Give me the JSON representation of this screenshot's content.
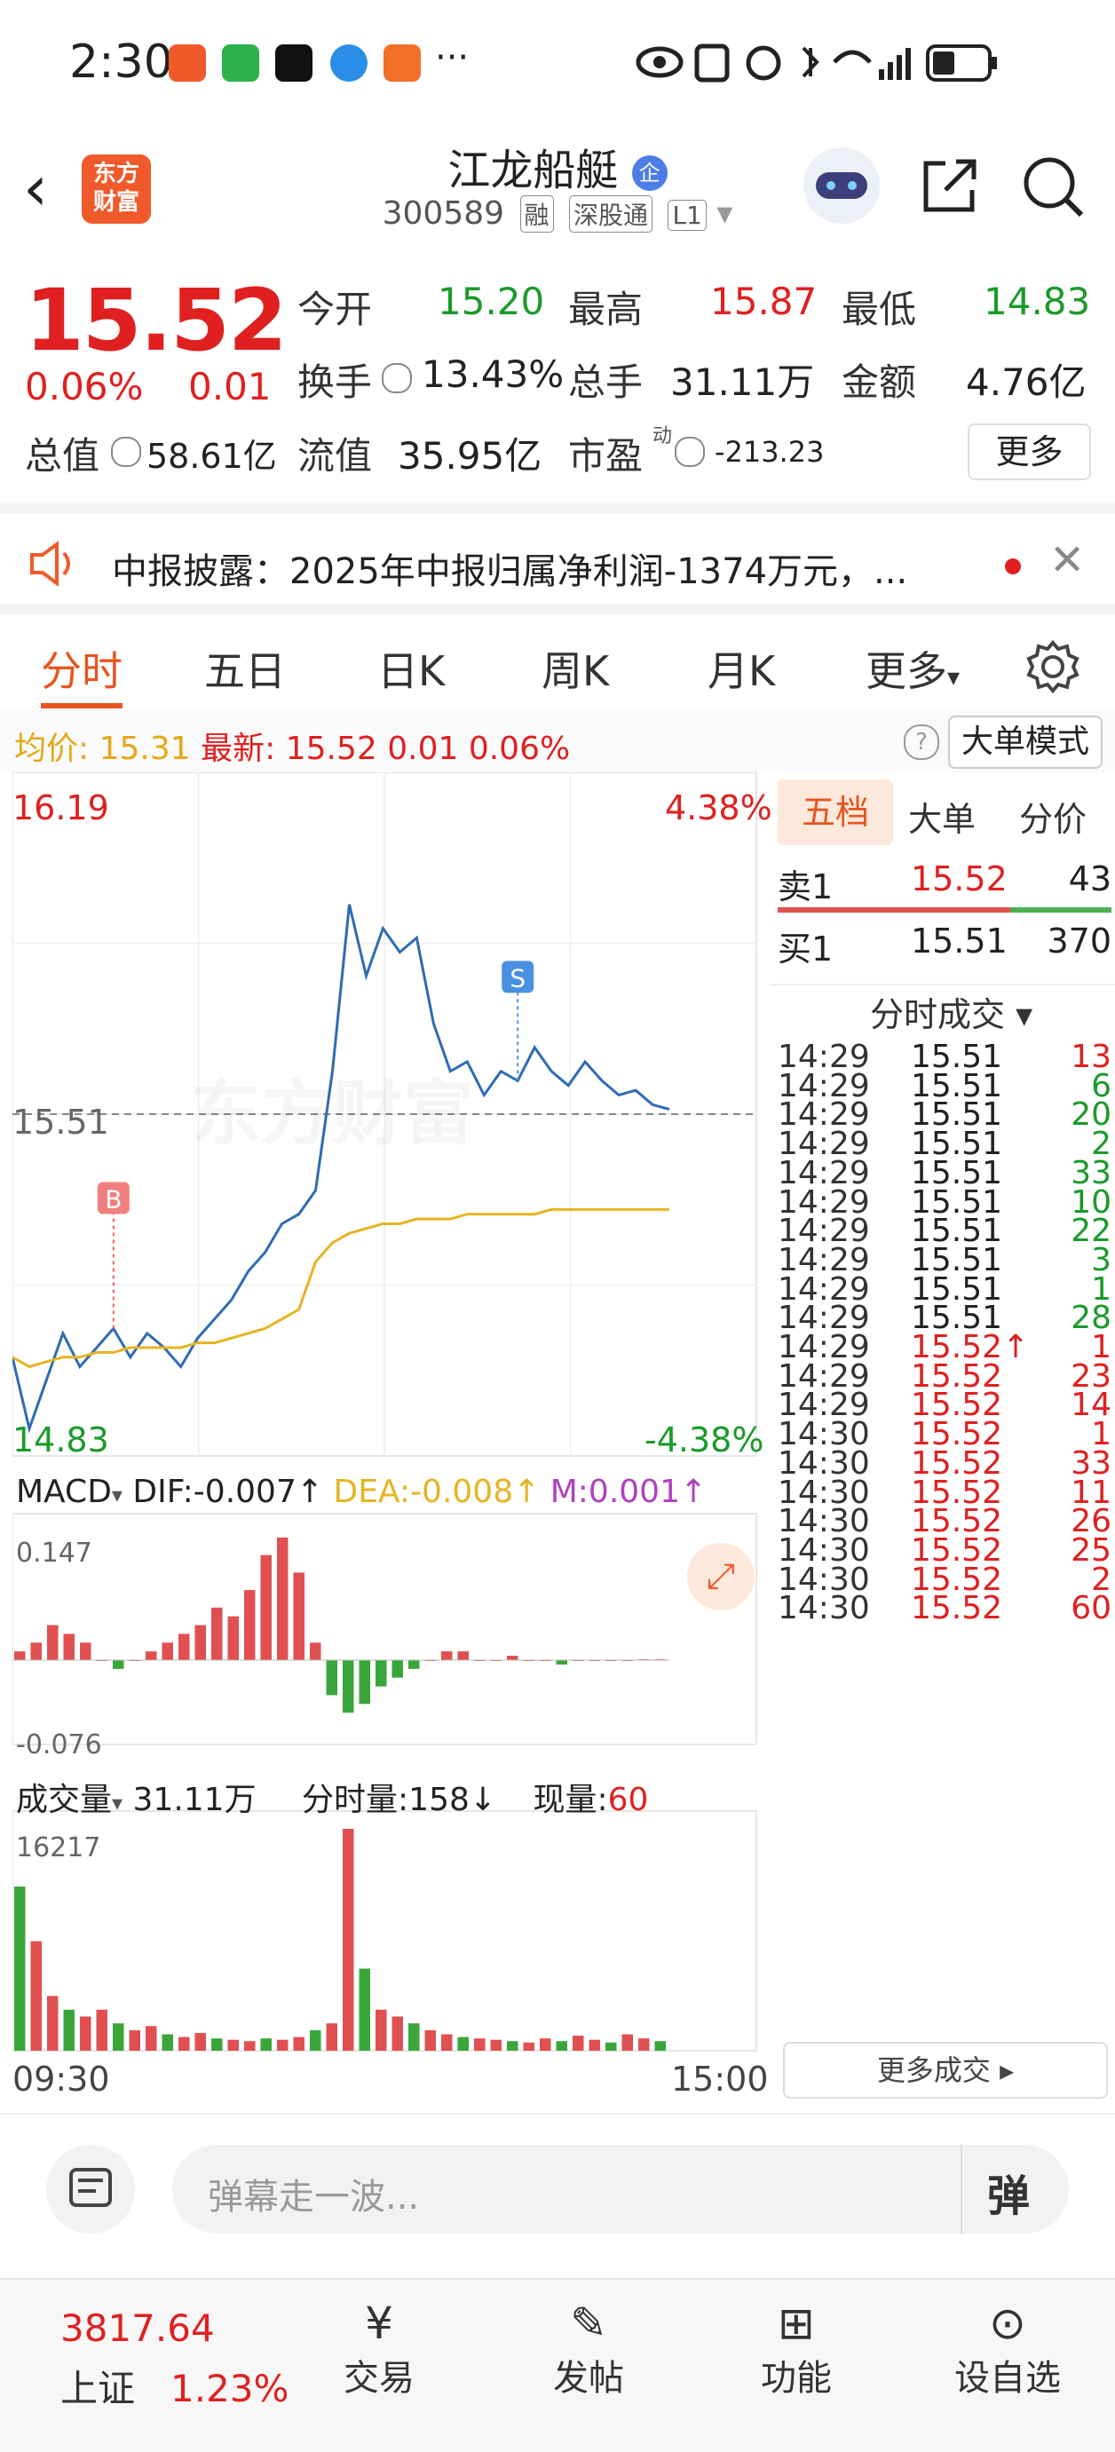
{
  "status_bar": {
    "time": "2:30",
    "more": "···"
  },
  "header": {
    "logo_text": "东方\n财富",
    "stock_name": "江龙船艇",
    "enterprise_badge": "企",
    "stock_code": "300589",
    "tags": [
      "融",
      "深股通",
      "L1"
    ]
  },
  "quote": {
    "price": "15.52",
    "change_pct": "0.06%",
    "change_amt": "0.01",
    "open_label": "今开",
    "open": "15.20",
    "high_label": "最高",
    "high": "15.87",
    "low_label": "最低",
    "low": "14.83",
    "turnover_label": "换手",
    "turnover": "13.43%",
    "volume_label": "总手",
    "volume": "31.11万",
    "amount_label": "金额",
    "amount": "4.76亿",
    "mktcap_label": "总值",
    "mktcap": "58.61亿",
    "float_label": "流值",
    "float": "35.95亿",
    "pe_label": "市盈",
    "pe_sup": "动",
    "pe": "-213.23",
    "more_button": "更多"
  },
  "banner": {
    "text": "中报披露：2025年中报归属净利润-1374万元，..."
  },
  "tabs": [
    "分时",
    "五日",
    "日K",
    "周K",
    "月K",
    "更多"
  ],
  "info_line": {
    "avg_label": "均价:",
    "avg": "15.31",
    "latest_label": "最新:",
    "latest": "15.52",
    "latest_chg": "0.01",
    "latest_pct": "0.06%",
    "mode_button": "大单模式"
  },
  "chart_data": {
    "type": "line",
    "price_top": "16.19",
    "price_bottom": "14.83",
    "pct_top": "4.38%",
    "pct_bottom": "-4.38%",
    "prev_close": "15.51",
    "watermark": "东方财富",
    "marker_s": "S",
    "marker_b": "B",
    "ylim": [
      14.83,
      16.19
    ],
    "series": [
      {
        "values": [
          15.0,
          14.85,
          14.95,
          15.05,
          14.98,
          15.02,
          15.06,
          15.0,
          15.05,
          15.02,
          14.98,
          15.04,
          15.08,
          15.12,
          15.18,
          15.22,
          15.28,
          15.3,
          15.35,
          15.6,
          15.95,
          15.8,
          15.9,
          15.85,
          15.88,
          15.7,
          15.6,
          15.62,
          15.55,
          15.6,
          15.58,
          15.65,
          15.6,
          15.57,
          15.62,
          15.58,
          15.55,
          15.56,
          15.53,
          15.52
        ]
      },
      {
        "values": [
          15.0,
          14.98,
          14.99,
          15.0,
          15.0,
          15.01,
          15.01,
          15.02,
          15.02,
          15.02,
          15.02,
          15.03,
          15.03,
          15.04,
          15.05,
          15.06,
          15.08,
          15.1,
          15.2,
          15.24,
          15.26,
          15.27,
          15.28,
          15.28,
          15.29,
          15.29,
          15.29,
          15.3,
          15.3,
          15.3,
          15.3,
          15.3,
          15.31,
          15.31,
          15.31,
          15.31,
          15.31,
          15.31,
          15.31,
          15.31
        ]
      }
    ],
    "time_start": "09:30",
    "time_end": "15:00",
    "macd": {
      "label": "MACD",
      "dif": "DIF:-0.007↑",
      "dea": "DEA:-0.008↑",
      "m": "M:0.001↑",
      "top": "0.147",
      "bottom": "-0.076",
      "hist": [
        0.01,
        0.02,
        0.04,
        0.03,
        0.02,
        0.0,
        -0.01,
        0.0,
        0.01,
        0.02,
        0.03,
        0.04,
        0.06,
        0.05,
        0.08,
        0.12,
        0.14,
        0.1,
        0.02,
        -0.04,
        -0.06,
        -0.05,
        -0.03,
        -0.02,
        -0.01,
        0.0,
        0.01,
        0.01,
        0.0,
        0.0,
        0.005,
        0.0,
        0.0,
        -0.005,
        0.0,
        0.0,
        0.0,
        0.0,
        0.001,
        0.001
      ]
    },
    "volume": {
      "label": "成交量",
      "total": "31.11万",
      "tick_label": "分时量:",
      "tick": "158↓",
      "now_label": "现量:",
      "now": "60",
      "top": "16217",
      "bars": [
        12000,
        8000,
        4000,
        3000,
        2500,
        3000,
        2000,
        1500,
        1800,
        1200,
        1000,
        1300,
        900,
        800,
        700,
        900,
        800,
        1000,
        1500,
        2000,
        16217,
        6000,
        3000,
        2500,
        2000,
        1500,
        1200,
        1000,
        900,
        800,
        700,
        600,
        900,
        700,
        1100,
        800,
        600,
        1200,
        900,
        700
      ]
    }
  },
  "orderbook": {
    "tabs": [
      "五档",
      "大单",
      "分价"
    ],
    "sell": {
      "label": "卖1",
      "price": "15.52",
      "vol": "43"
    },
    "buy": {
      "label": "买1",
      "price": "15.51",
      "vol": "370"
    },
    "ticks_header": "分时成交",
    "ticks": [
      {
        "t": "14:29",
        "p": "15.51",
        "v": "13",
        "c": "red"
      },
      {
        "t": "14:29",
        "p": "15.51",
        "v": "6",
        "c": "green"
      },
      {
        "t": "14:29",
        "p": "15.51",
        "v": "20",
        "c": "green"
      },
      {
        "t": "14:29",
        "p": "15.51",
        "v": "2",
        "c": "green"
      },
      {
        "t": "14:29",
        "p": "15.51",
        "v": "33",
        "c": "green"
      },
      {
        "t": "14:29",
        "p": "15.51",
        "v": "10",
        "c": "green"
      },
      {
        "t": "14:29",
        "p": "15.51",
        "v": "22",
        "c": "green"
      },
      {
        "t": "14:29",
        "p": "15.51",
        "v": "3",
        "c": "green"
      },
      {
        "t": "14:29",
        "p": "15.51",
        "v": "1",
        "c": "green"
      },
      {
        "t": "14:29",
        "p": "15.51",
        "v": "28",
        "c": "green"
      },
      {
        "t": "14:29",
        "p": "15.52↑",
        "v": "1",
        "c": "red",
        "pc": "red"
      },
      {
        "t": "14:29",
        "p": "15.52",
        "v": "23",
        "c": "red",
        "pc": "red"
      },
      {
        "t": "14:29",
        "p": "15.52",
        "v": "14",
        "c": "red",
        "pc": "red"
      },
      {
        "t": "14:30",
        "p": "15.52",
        "v": "1",
        "c": "red",
        "pc": "red"
      },
      {
        "t": "14:30",
        "p": "15.52",
        "v": "33",
        "c": "red",
        "pc": "red"
      },
      {
        "t": "14:30",
        "p": "15.52",
        "v": "11",
        "c": "red",
        "pc": "red"
      },
      {
        "t": "14:30",
        "p": "15.52",
        "v": "26",
        "c": "red",
        "pc": "red"
      },
      {
        "t": "14:30",
        "p": "15.52",
        "v": "25",
        "c": "red",
        "pc": "red"
      },
      {
        "t": "14:30",
        "p": "15.52",
        "v": "2",
        "c": "red",
        "pc": "red"
      },
      {
        "t": "14:30",
        "p": "15.52",
        "v": "60",
        "c": "red",
        "pc": "red"
      }
    ],
    "more_ticks": "更多成交"
  },
  "comment_bar": {
    "placeholder": "弹幕走一波...",
    "danmu_button": "弹"
  },
  "bottom_nav": {
    "index_value": "3817.64",
    "index_name": "上证",
    "index_pct": "1.23%",
    "items": [
      "交易",
      "发帖",
      "功能",
      "设自选"
    ]
  },
  "colors": {
    "up": "#e02020",
    "down": "#1a9a2a",
    "brand": "#f05a2a",
    "avg_line": "#e6b422",
    "price_line": "#2e6bb5"
  }
}
